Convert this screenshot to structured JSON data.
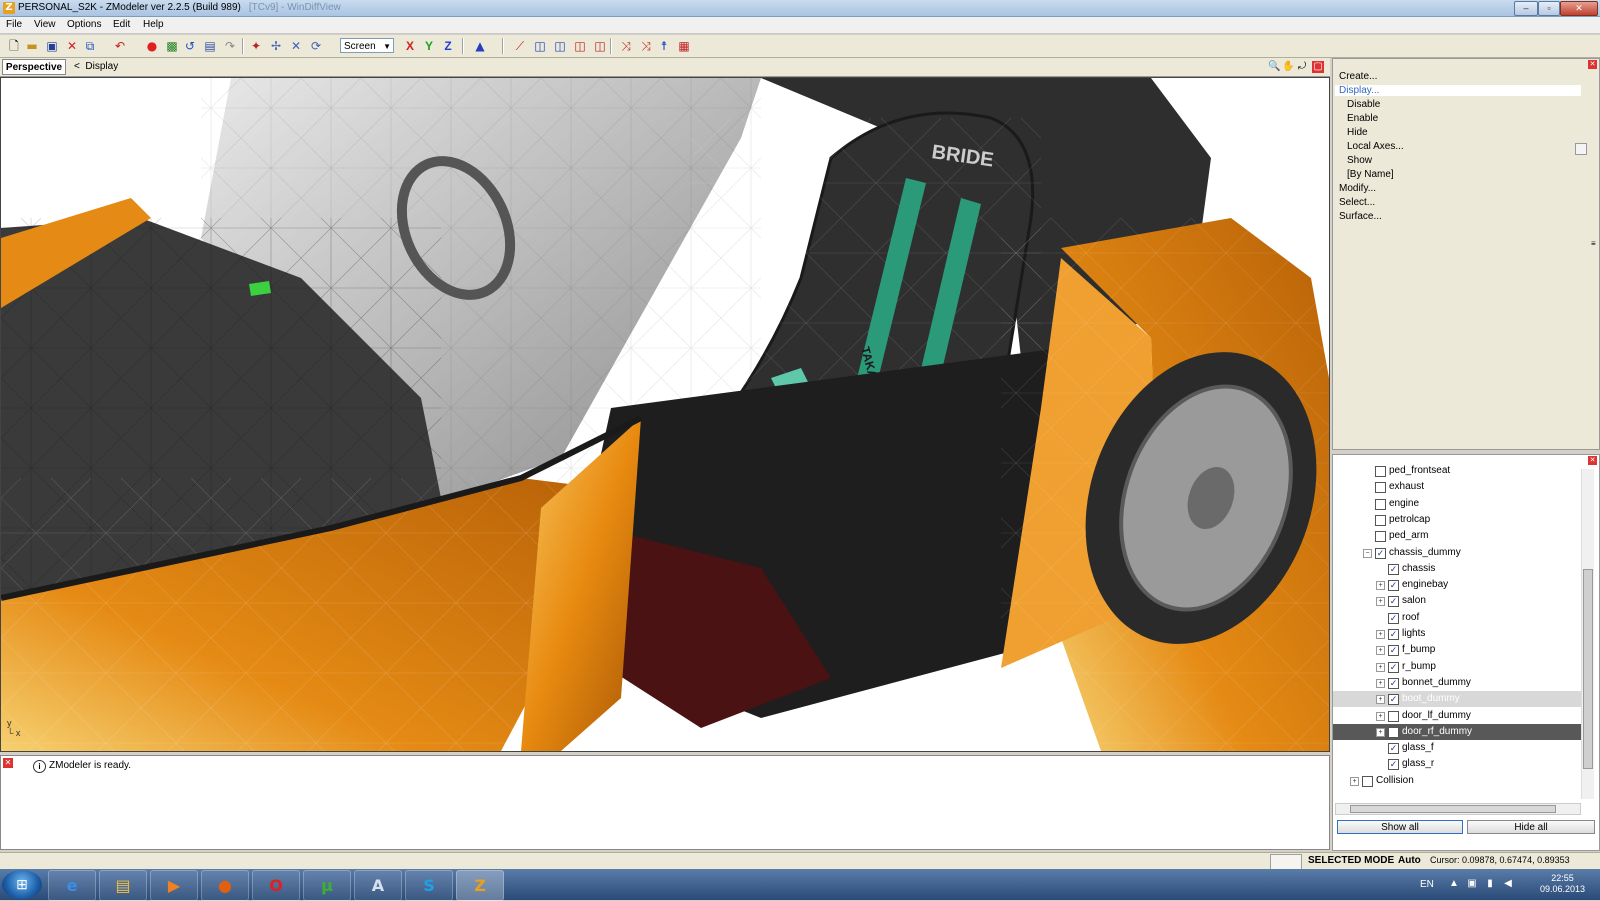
{
  "window": {
    "title": "PERSONAL_S2K - ZModeler ver 2.2.5 (Build 989)",
    "title_ghost": "[TCv9] - WinDiffView",
    "controls": [
      "minimize",
      "maximize",
      "close"
    ]
  },
  "menu": {
    "items": [
      "File",
      "View",
      "Options",
      "Edit",
      "Help"
    ]
  },
  "toolbar": {
    "screen_mode": "Screen",
    "axis_x": "X",
    "axis_y": "Y",
    "axis_z": "Z",
    "icons": [
      "new-file-icon",
      "open-folder-icon",
      "save-icon",
      "delete-icon",
      "copy-icon",
      "undo-dropdown-icon",
      "record-icon",
      "image-icon",
      "refresh-icon",
      "properties-icon",
      "redo-icon",
      "select-icon",
      "move-icon",
      "scale-icon",
      "rotate-icon",
      "grid-icon",
      "anchor-icon",
      "vertex-tool-icon",
      "cube-icon",
      "cube-multi-icon",
      "cube-red-icon",
      "cube-cut-icon",
      "pick-icon",
      "pick2-icon",
      "figure-icon",
      "group-icon"
    ]
  },
  "viewport": {
    "tab": "Perspective",
    "display_label": "Display",
    "car_colors": {
      "body": "#e58a14",
      "body_light": "#f6d070",
      "seat": "#2f2f2f",
      "belt": "#2a9a78",
      "floor": "#4a1212",
      "glass": "#c8c8c8"
    },
    "seat_brand": "BRIDE",
    "belt_brand": "TAKATA"
  },
  "log": {
    "message": "ZModeler is ready."
  },
  "command_panel": {
    "items": [
      {
        "label": "Create...",
        "level": 0,
        "selected": false
      },
      {
        "label": "Display...",
        "level": 0,
        "selected": true
      },
      {
        "label": "Disable",
        "level": 1,
        "selected": false
      },
      {
        "label": "Enable",
        "level": 1,
        "selected": false
      },
      {
        "label": "Hide",
        "level": 1,
        "selected": false
      },
      {
        "label": "Local Axes...",
        "level": 1,
        "selected": false
      },
      {
        "label": "Show",
        "level": 1,
        "selected": false
      },
      {
        "label": "[By Name]",
        "level": 1,
        "selected": false
      },
      {
        "label": "Modify...",
        "level": 0,
        "selected": false
      },
      {
        "label": "Select...",
        "level": 0,
        "selected": false
      },
      {
        "label": "Surface...",
        "level": 0,
        "selected": false
      }
    ]
  },
  "hierarchy": {
    "rows": [
      {
        "label": "ped_frontseat",
        "indent": 2,
        "checked": false,
        "expandable": false,
        "highlight": ""
      },
      {
        "label": "exhaust",
        "indent": 2,
        "checked": false,
        "expandable": false,
        "highlight": ""
      },
      {
        "label": "engine",
        "indent": 2,
        "checked": false,
        "expandable": false,
        "highlight": ""
      },
      {
        "label": "petrolcap",
        "indent": 2,
        "checked": false,
        "expandable": false,
        "highlight": ""
      },
      {
        "label": "ped_arm",
        "indent": 2,
        "checked": false,
        "expandable": false,
        "highlight": ""
      },
      {
        "label": "chassis_dummy",
        "indent": 2,
        "checked": true,
        "expandable": true,
        "expanded": true,
        "highlight": ""
      },
      {
        "label": "chassis",
        "indent": 3,
        "checked": true,
        "expandable": false,
        "highlight": ""
      },
      {
        "label": "enginebay",
        "indent": 3,
        "checked": true,
        "expandable": true,
        "highlight": ""
      },
      {
        "label": "salon",
        "indent": 3,
        "checked": true,
        "expandable": true,
        "highlight": ""
      },
      {
        "label": "roof",
        "indent": 3,
        "checked": true,
        "expandable": false,
        "highlight": ""
      },
      {
        "label": "lights",
        "indent": 3,
        "checked": true,
        "expandable": true,
        "highlight": ""
      },
      {
        "label": "f_bump",
        "indent": 3,
        "checked": true,
        "expandable": true,
        "highlight": ""
      },
      {
        "label": "r_bump",
        "indent": 3,
        "checked": true,
        "expandable": true,
        "highlight": ""
      },
      {
        "label": "bonnet_dummy",
        "indent": 3,
        "checked": true,
        "expandable": true,
        "highlight": ""
      },
      {
        "label": "boot_dummy",
        "indent": 3,
        "checked": true,
        "expandable": true,
        "highlight": "light"
      },
      {
        "label": "door_lf_dummy",
        "indent": 3,
        "checked": false,
        "expandable": true,
        "highlight": ""
      },
      {
        "label": "door_rf_dummy",
        "indent": 3,
        "checked": false,
        "expandable": true,
        "highlight": "dark"
      },
      {
        "label": "glass_f",
        "indent": 3,
        "checked": true,
        "expandable": false,
        "highlight": ""
      },
      {
        "label": "glass_r",
        "indent": 3,
        "checked": true,
        "expandable": false,
        "highlight": ""
      },
      {
        "label": "Collision",
        "indent": 1,
        "checked": false,
        "expandable": true,
        "highlight": ""
      }
    ],
    "show_all": "Show all",
    "hide_all": "Hide all"
  },
  "status": {
    "mode": "SELECTED MODE",
    "auto": "Auto",
    "cursor": "Cursor: 0.09878, 0.67474, 0.89353"
  },
  "taskbar": {
    "apps": [
      {
        "name": "ie-icon",
        "glyph": "e",
        "color": "#3a8ee6"
      },
      {
        "name": "explorer-icon",
        "glyph": "▤",
        "color": "#f0c040"
      },
      {
        "name": "media-player-icon",
        "glyph": "▶",
        "color": "#f08020"
      },
      {
        "name": "firefox-icon",
        "glyph": "●",
        "color": "#e06010"
      },
      {
        "name": "opera-icon",
        "glyph": "O",
        "color": "#e02020"
      },
      {
        "name": "utorrent-icon",
        "glyph": "µ",
        "color": "#3cb030"
      },
      {
        "name": "notepad-icon",
        "glyph": "A",
        "color": "#d8e0f0"
      },
      {
        "name": "skype-icon",
        "glyph": "S",
        "color": "#20a0e8"
      },
      {
        "name": "zmodeler-icon",
        "glyph": "Z",
        "color": "#e8a020"
      }
    ],
    "lang": "EN",
    "time": "22:55",
    "date": "09.06.2013"
  }
}
